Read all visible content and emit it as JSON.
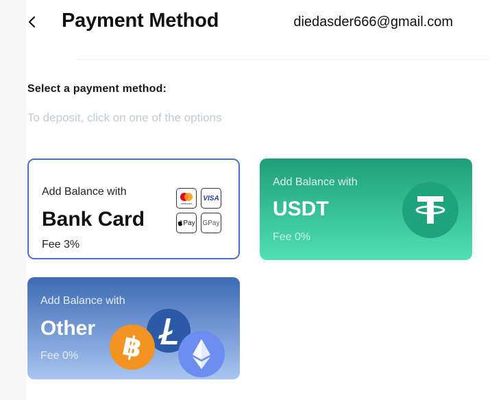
{
  "header": {
    "title": "Payment Method",
    "email": "diedasder666@gmail.com"
  },
  "section": {
    "title": "Select a payment method:",
    "hint": "To deposit, click on one of the options"
  },
  "cards": [
    {
      "lead": "Add Balance with",
      "method": "Bank Card",
      "fee": "Fee 3%",
      "badges": [
        "mastercard",
        "VISA",
        "Pay",
        "GPay"
      ]
    },
    {
      "lead": "Add Balance with",
      "method": "USDT",
      "fee": "Fee 0%"
    },
    {
      "lead": "Add Balance with",
      "method": "Other",
      "fee": "Fee 0%"
    }
  ],
  "colors": {
    "bank_border": "#4a6fd1",
    "usdt_top": "#1f9e78",
    "usdt_bottom": "#4fe0b4",
    "other_top": "#3d6ab5",
    "other_bottom": "#a9c5f1",
    "btc": "#f39321",
    "ltc": "#2b5aa6",
    "eth": "#6d8ef0"
  },
  "icons": {
    "back": "chevron-left-icon",
    "mastercard": "mastercard-icon",
    "visa": "visa-icon",
    "apple_pay": "apple-pay-icon",
    "google_pay": "google-pay-icon",
    "tether": "tether-icon",
    "bitcoin": "bitcoin-icon",
    "litecoin": "litecoin-icon",
    "ethereum": "ethereum-icon"
  }
}
